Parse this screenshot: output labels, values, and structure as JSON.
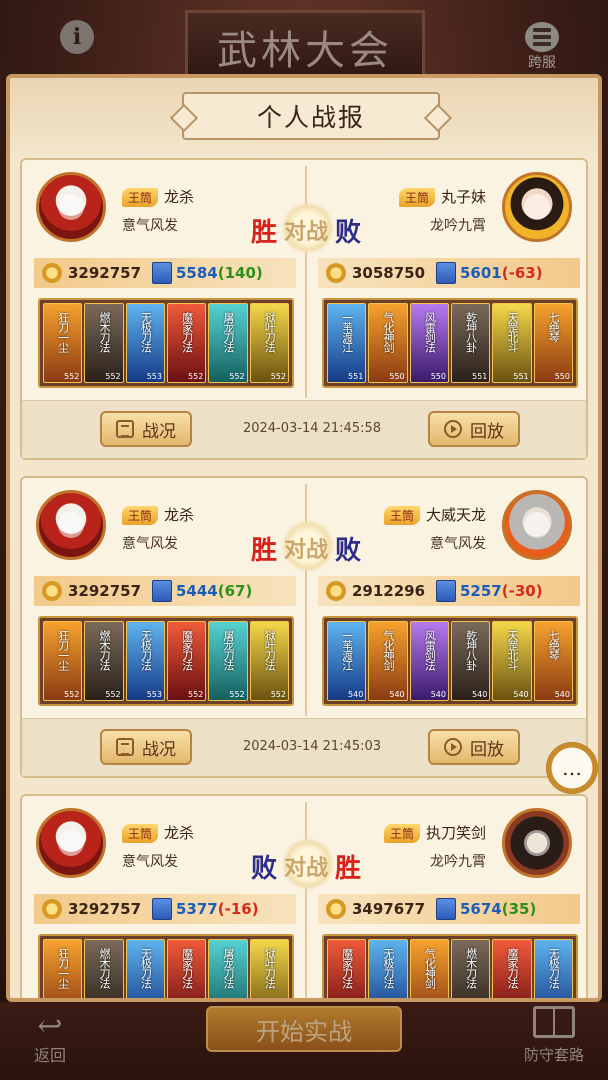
{
  "top": {
    "title": "武林大会",
    "info_label": "i",
    "cross_server_label": "跨服"
  },
  "panel": {
    "title": "个人战报"
  },
  "vs_label": "对战",
  "button_labels": {
    "report": "战况",
    "replay": "回放"
  },
  "battles": [
    {
      "left": {
        "rank": "王筒",
        "name": "龙杀",
        "motto": "意气风发",
        "power": "3292757",
        "score": "5584",
        "delta": "(140)",
        "result": "胜",
        "heroes": [
          {
            "title": "狂刀一尘",
            "lv": "552"
          },
          {
            "title": "燃木刀法",
            "lv": "552"
          },
          {
            "title": "无极刀法",
            "lv": "553"
          },
          {
            "title": "魔家刀法",
            "lv": "552"
          },
          {
            "title": "屠龙刀法",
            "lv": "552"
          },
          {
            "title": "狱叶刀法",
            "lv": "552"
          }
        ]
      },
      "right": {
        "rank": "王筒",
        "name": "丸子妹",
        "motto": "龙吟九霄",
        "power": "3058750",
        "score": "5601",
        "delta": "(-63)",
        "result": "败",
        "heroes": [
          {
            "title": "一苇渡江",
            "lv": "551"
          },
          {
            "title": "气化神剑",
            "lv": "550"
          },
          {
            "title": "风雷剑法",
            "lv": "550"
          },
          {
            "title": "乾坤八卦",
            "lv": "551"
          },
          {
            "title": "天罡北斗",
            "lv": "551"
          },
          {
            "title": "七绝琴",
            "lv": "550"
          }
        ]
      },
      "timestamp": "2024-03-14 21:45:58"
    },
    {
      "left": {
        "rank": "王筒",
        "name": "龙杀",
        "motto": "意气风发",
        "power": "3292757",
        "score": "5444",
        "delta": "(67)",
        "result": "胜",
        "heroes": [
          {
            "title": "狂刀一尘",
            "lv": "552"
          },
          {
            "title": "燃木刀法",
            "lv": "552"
          },
          {
            "title": "无极刀法",
            "lv": "553"
          },
          {
            "title": "魔家刀法",
            "lv": "552"
          },
          {
            "title": "屠龙刀法",
            "lv": "552"
          },
          {
            "title": "狱叶刀法",
            "lv": "552"
          }
        ]
      },
      "right": {
        "rank": "王筒",
        "name": "大威天龙",
        "motto": "意气风发",
        "power": "2912296",
        "score": "5257",
        "delta": "(-30)",
        "result": "败",
        "heroes": [
          {
            "title": "一苇渡江",
            "lv": "540"
          },
          {
            "title": "气化神剑",
            "lv": "540"
          },
          {
            "title": "风雷剑法",
            "lv": "540"
          },
          {
            "title": "乾坤八卦",
            "lv": "540"
          },
          {
            "title": "天罡北斗",
            "lv": "540"
          },
          {
            "title": "七绝琴",
            "lv": "540"
          }
        ]
      },
      "timestamp": "2024-03-14 21:45:03"
    },
    {
      "left": {
        "rank": "王筒",
        "name": "龙杀",
        "motto": "意气风发",
        "power": "3292757",
        "score": "5377",
        "delta": "(-16)",
        "result": "败",
        "heroes": [
          {
            "title": "狂刀一尘",
            "lv": ""
          },
          {
            "title": "燃木刀法",
            "lv": ""
          },
          {
            "title": "无极刀法",
            "lv": ""
          },
          {
            "title": "魔家刀法",
            "lv": ""
          },
          {
            "title": "屠龙刀法",
            "lv": ""
          },
          {
            "title": "狱叶刀法",
            "lv": ""
          }
        ]
      },
      "right": {
        "rank": "王筒",
        "name": "执刀笑剑",
        "motto": "龙吟九霄",
        "power": "3497677",
        "score": "5674",
        "delta": "(35)",
        "result": "胜",
        "heroes": [
          {
            "title": "魔家刀法",
            "lv": ""
          },
          {
            "title": "无极刀法",
            "lv": ""
          },
          {
            "title": "气化神剑",
            "lv": ""
          },
          {
            "title": "燃木刀法",
            "lv": ""
          },
          {
            "title": "魔家刀法",
            "lv": ""
          },
          {
            "title": "无极刀法",
            "lv": ""
          }
        ]
      },
      "timestamp": ""
    }
  ],
  "footer": {
    "back_label": "返回",
    "train_label": "开始实战",
    "defense_label": "防守套路"
  },
  "colors": {
    "win": "#d6221b",
    "lose": "#2d2d86",
    "delta_positive": "#2f8f1a",
    "delta_negative": "#d62a1a",
    "score": "#1c5db8",
    "panel_bg": "#f3e6cc",
    "accent_gold": "#c89a62"
  }
}
